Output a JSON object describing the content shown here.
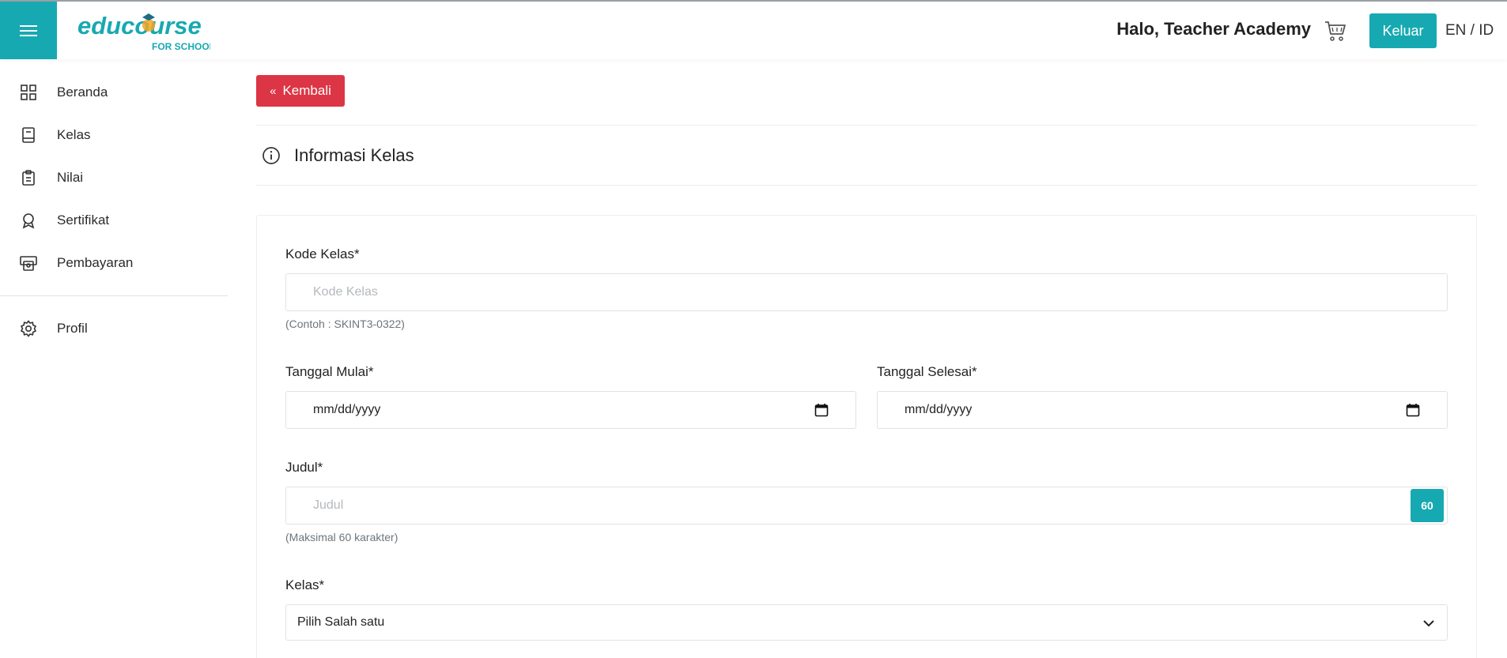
{
  "header": {
    "logo_main": "educourse",
    "logo_sub": "FOR SCHOOL",
    "greeting": "Halo, Teacher Academy",
    "logout_label": "Keluar",
    "lang_en": "EN",
    "lang_sep": " / ",
    "lang_id": "ID"
  },
  "sidebar": {
    "items": [
      {
        "label": "Beranda",
        "icon": "grid-icon"
      },
      {
        "label": "Kelas",
        "icon": "book-icon"
      },
      {
        "label": "Nilai",
        "icon": "clipboard-icon"
      },
      {
        "label": "Sertifikat",
        "icon": "award-icon"
      },
      {
        "label": "Pembayaran",
        "icon": "payment-icon"
      }
    ],
    "profile": {
      "label": "Profil",
      "icon": "gear-icon"
    }
  },
  "main": {
    "back_label": "Kembali",
    "section_title": "Informasi Kelas",
    "form": {
      "kode": {
        "label": "Kode Kelas*",
        "placeholder": "Kode Kelas",
        "hint": "(Contoh : SKINT3-0322)"
      },
      "start": {
        "label": "Tanggal Mulai*",
        "value": "mm/dd/yyyy"
      },
      "end": {
        "label": "Tanggal Selesai*",
        "value": "mm/dd/yyyy"
      },
      "judul": {
        "label": "Judul*",
        "placeholder": "Judul",
        "counter": "60",
        "hint": "(Maksimal 60 karakter)"
      },
      "kelas": {
        "label": "Kelas*",
        "selected": "Pilih Salah satu"
      }
    }
  },
  "colors": {
    "accent": "#17a9b1",
    "danger": "#dc3545",
    "logo_orange": "#f5a623"
  }
}
